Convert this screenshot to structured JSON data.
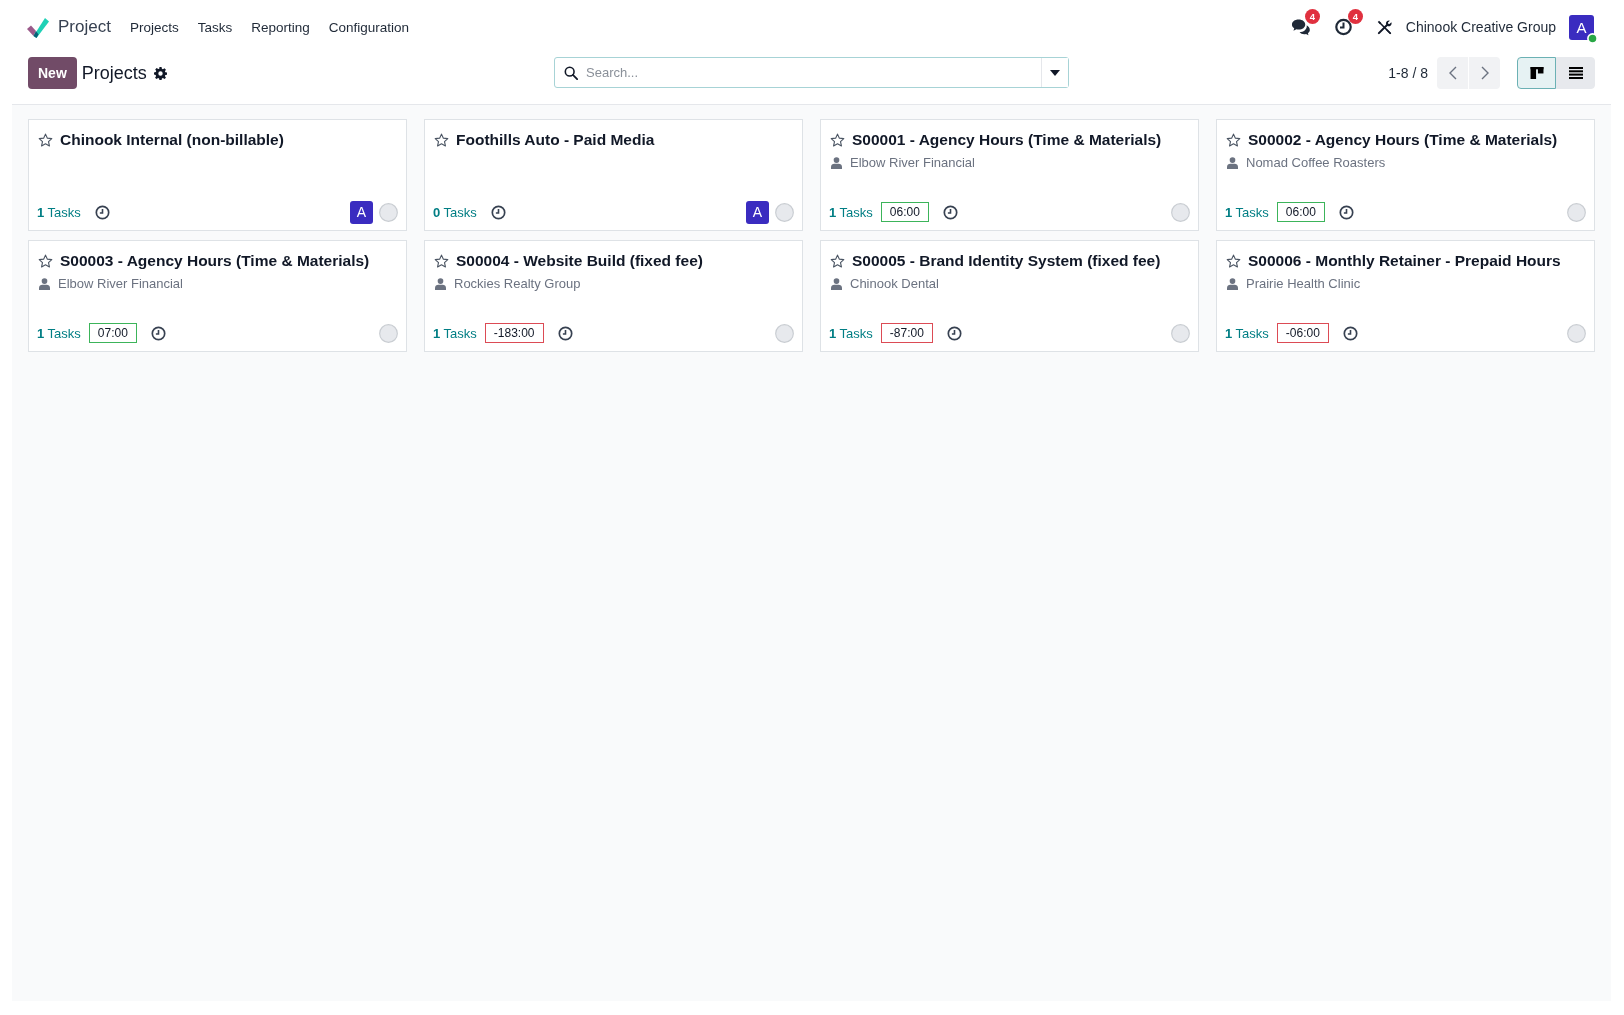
{
  "navbar": {
    "app_name": "Project",
    "menu": [
      "Projects",
      "Tasks",
      "Reporting",
      "Configuration"
    ],
    "messages_count": "4",
    "activities_count": "4",
    "company": "Chinook Creative Group",
    "user": {
      "initial": "A",
      "online": true
    }
  },
  "control_panel": {
    "new_button": "New",
    "breadcrumb": "Projects",
    "search": {
      "placeholder": "Search..."
    },
    "pager": "1-8 / 8",
    "views": [
      {
        "kind": "kanban",
        "selected": true
      },
      {
        "kind": "list",
        "selected": false
      }
    ]
  },
  "projects": [
    {
      "name": "Chinook Internal (non-billable)",
      "favorite": false,
      "tasks": "**1** Tasks",
      "assignee": "A"
    },
    {
      "name": "Foothills Auto - Paid Media",
      "favorite": false,
      "tasks": "**0** Tasks",
      "assignee": "A"
    },
    {
      "name": "S00001 - Agency Hours (Time & Materials)",
      "favorite": false,
      "customer": "Elbow River Financial",
      "tasks": "**1** Tasks",
      "remaining_hours": {
        "value": "06:00",
        "exceeded": false
      }
    },
    {
      "name": "S00002 - Agency Hours (Time & Materials)",
      "favorite": false,
      "customer": "Nomad Coffee Roasters",
      "tasks": "**1** Tasks",
      "remaining_hours": {
        "value": "06:00",
        "exceeded": false
      }
    },
    {
      "name": "S00003 - Agency Hours (Time & Materials)",
      "favorite": false,
      "customer": "Elbow River Financial",
      "tasks": "**1** Tasks",
      "remaining_hours": {
        "value": "07:00",
        "exceeded": false
      }
    },
    {
      "name": "S00004 - Website Build (fixed fee)",
      "favorite": false,
      "customer": "Rockies Realty Group",
      "tasks": "**1** Tasks",
      "remaining_hours": {
        "value": "-183:00",
        "exceeded": true
      }
    },
    {
      "name": "S00005 - Brand Identity System (fixed fee)",
      "favorite": false,
      "customer": "Chinook Dental",
      "tasks": "**1** Tasks",
      "remaining_hours": {
        "value": "-87:00",
        "exceeded": true
      }
    },
    {
      "name": "S00006 - Monthly Retainer - Prepaid Hours",
      "favorite": false,
      "customer": "Prairie Health Clinic",
      "tasks": "**1** Tasks",
      "remaining_hours": {
        "value": "-06:00",
        "exceeded": true
      }
    }
  ]
}
